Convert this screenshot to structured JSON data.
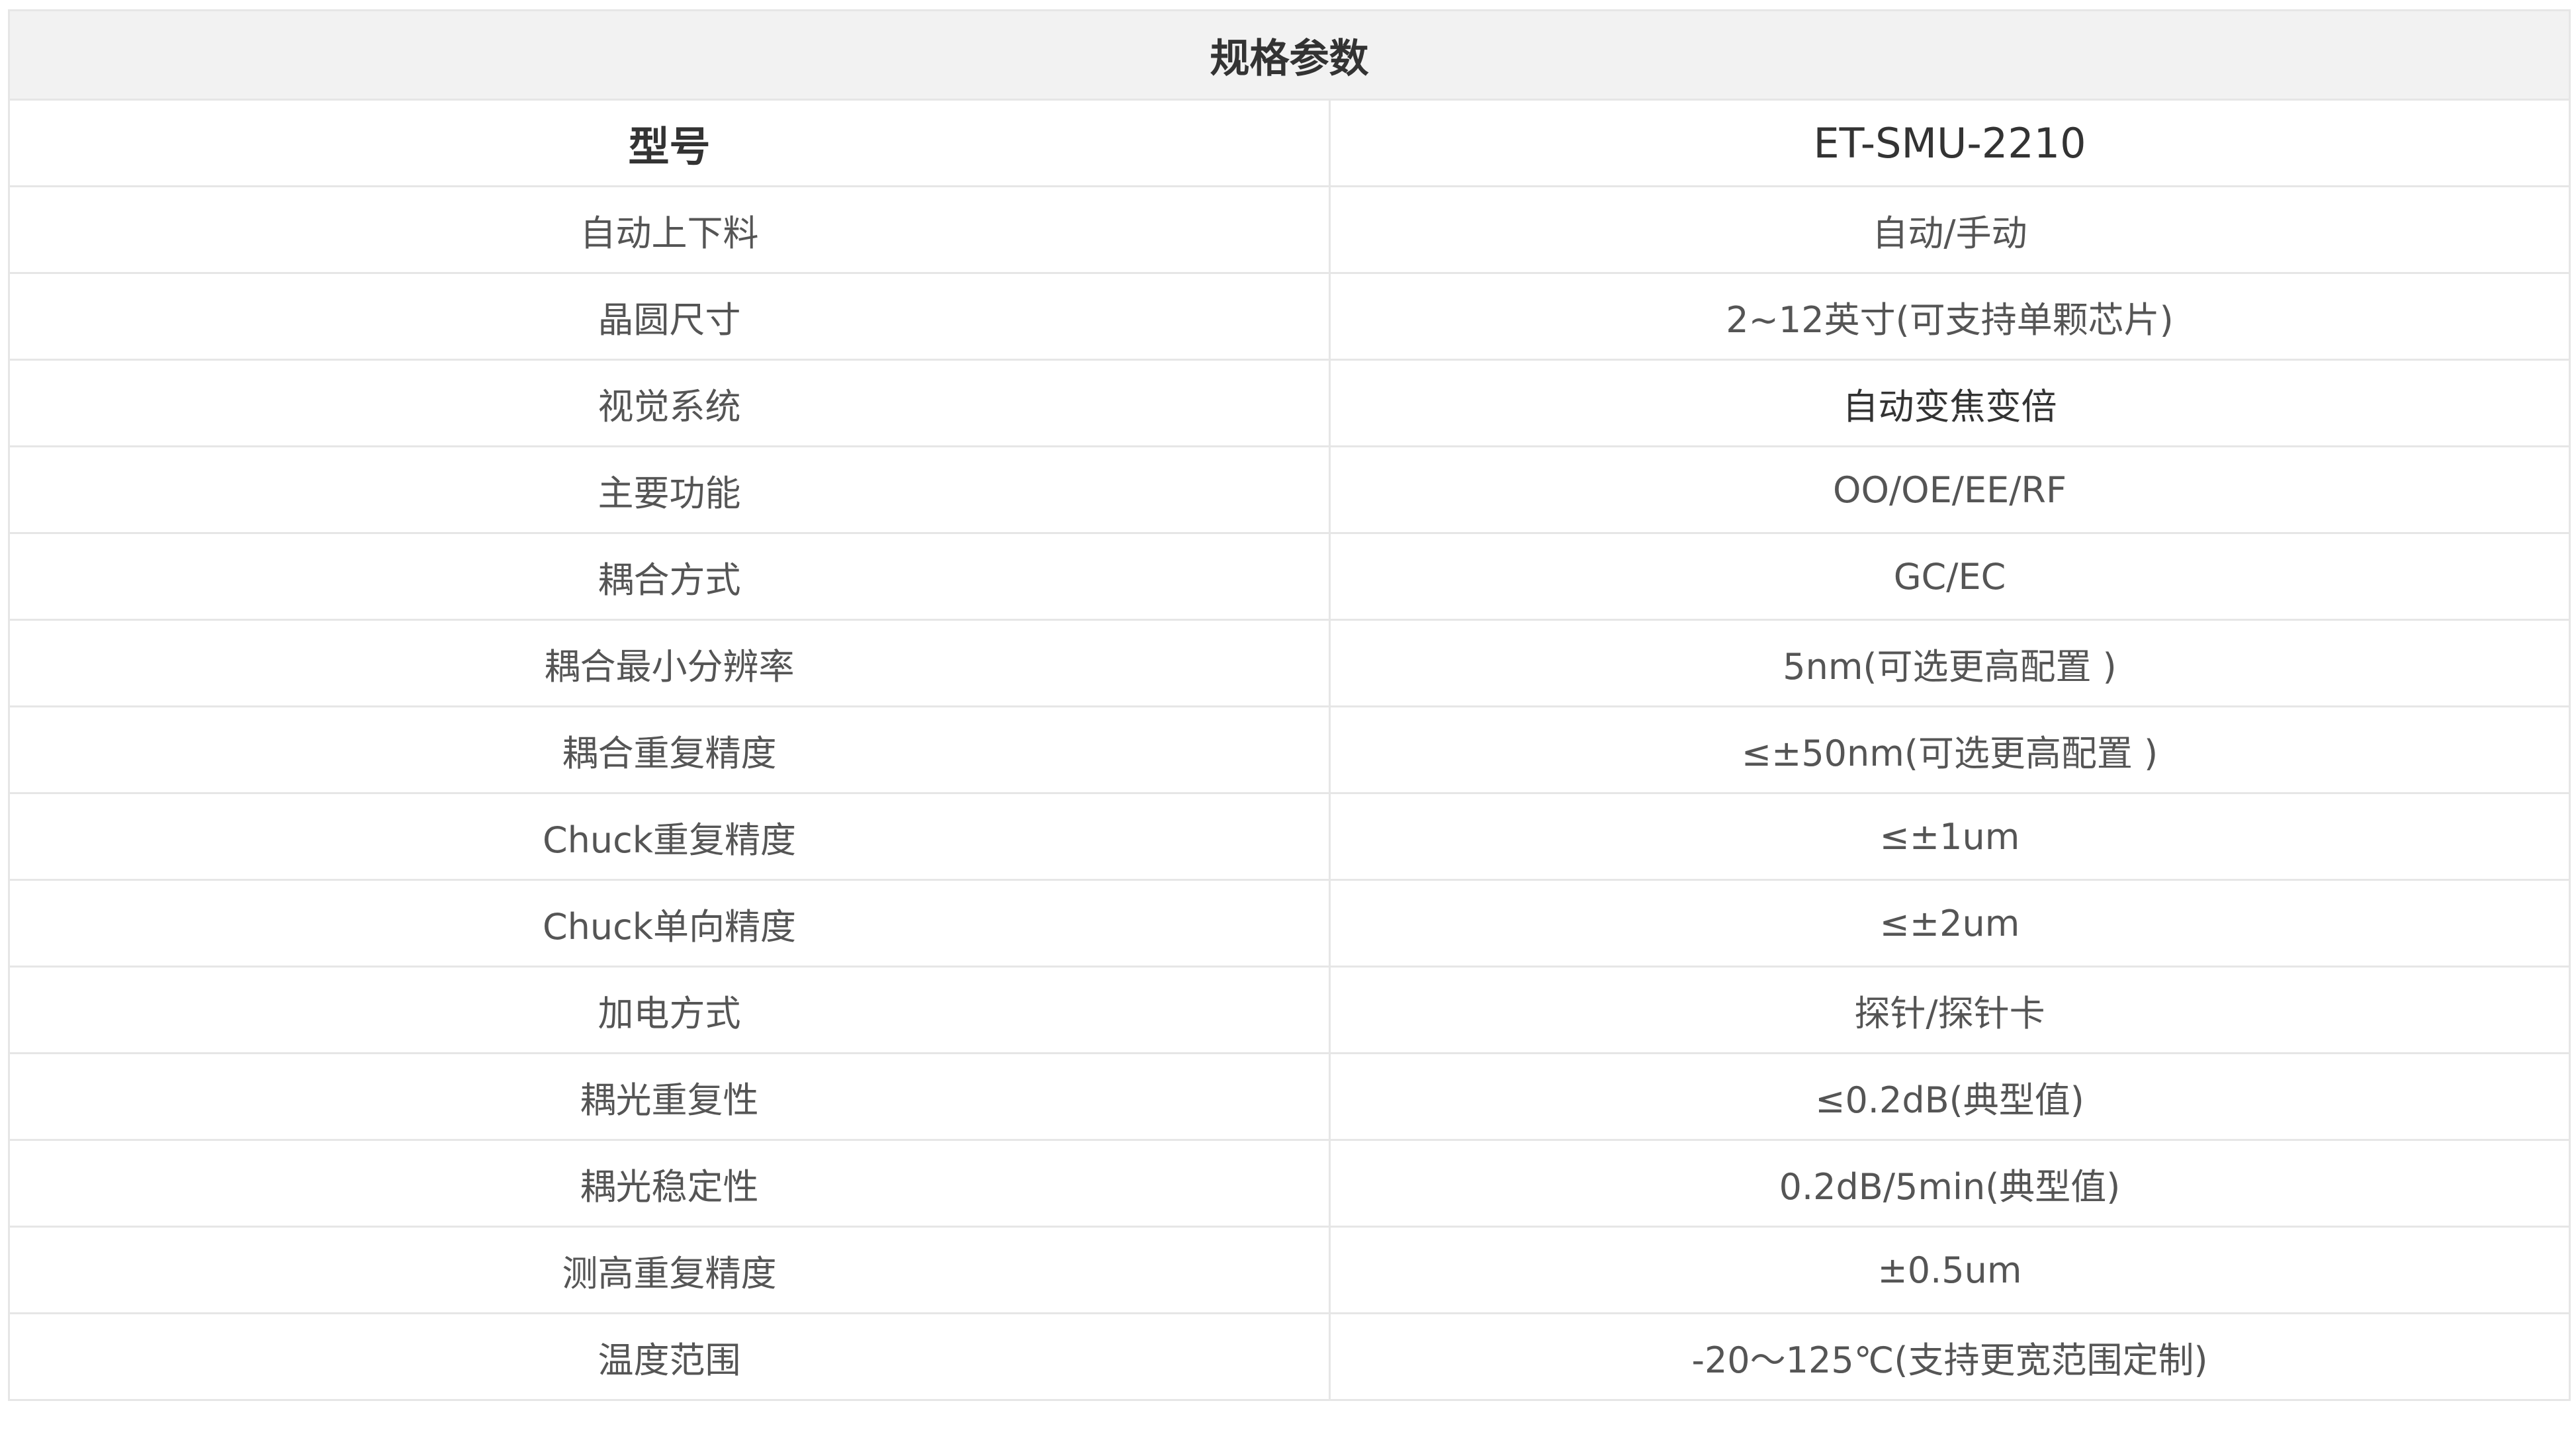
{
  "table": {
    "title": "规格参数",
    "header": {
      "label": "型号",
      "value": "ET-SMU-2210"
    },
    "rows": [
      {
        "label": "自动上下料",
        "value": "自动/手动"
      },
      {
        "label": "晶圆尺寸",
        "value": "2~12英寸(可支持单颗芯片)"
      },
      {
        "label": "视觉系统",
        "value": "自动变焦变倍"
      },
      {
        "label": "主要功能",
        "value": "OO/OE/EE/RF"
      },
      {
        "label": "耦合方式",
        "value": "GC/EC"
      },
      {
        "label": "耦合最小分辨率",
        "value": "5nm(可选更高配置 )"
      },
      {
        "label": "耦合重复精度",
        "value": "≤±50nm(可选更高配置 )"
      },
      {
        "label": "Chuck重复精度",
        "value": "≤±1um"
      },
      {
        "label": "Chuck单向精度",
        "value": "≤±2um"
      },
      {
        "label": "加电方式",
        "value": "探针/探针卡"
      },
      {
        "label": "耦光重复性",
        "value": "≤0.2dB(典型值)"
      },
      {
        "label": "耦光稳定性",
        "value": "0.2dB/5min(典型值)"
      },
      {
        "label": "测高重复精度",
        "value": "±0.5um"
      },
      {
        "label": "温度范围",
        "value": "-20～125℃(支持更宽范围定制)"
      }
    ]
  }
}
